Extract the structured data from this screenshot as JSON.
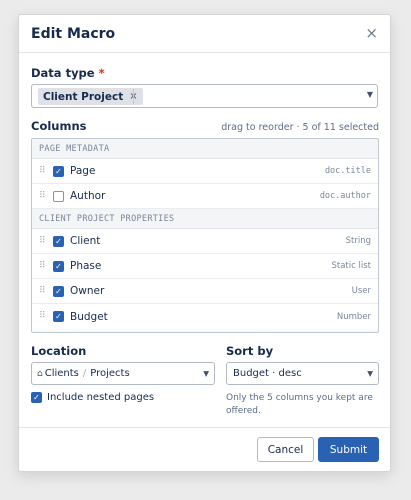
{
  "dialog": {
    "title": "Edit Macro",
    "close_glyph": "×"
  },
  "data_type": {
    "label": "Data type",
    "required_mark": "*",
    "selected_chip": "Client Project",
    "chip_remove_glyph": "×"
  },
  "columns": {
    "label": "Columns",
    "hint": "drag to reorder · 5 of 11 selected",
    "groups": [
      {
        "heading": "PAGE METADATA",
        "rows": [
          {
            "label": "Page",
            "meta": "doc.title",
            "checked": true
          },
          {
            "label": "Author",
            "meta": "doc.author",
            "checked": false
          }
        ]
      },
      {
        "heading": "CLIENT PROJECT PROPERTIES",
        "rows": [
          {
            "label": "Client",
            "meta": "String",
            "checked": true
          },
          {
            "label": "Phase",
            "meta": "Static list",
            "checked": true
          },
          {
            "label": "Owner",
            "meta": "User",
            "checked": true
          },
          {
            "label": "Budget",
            "meta": "Number",
            "checked": true
          }
        ]
      }
    ]
  },
  "location": {
    "label": "Location",
    "path": [
      "Clients",
      "Projects"
    ],
    "path_separator": "/",
    "include_nested_label": "Include nested pages",
    "include_nested_checked": true
  },
  "sort": {
    "label": "Sort by",
    "value": "Budget · desc",
    "note": "Only the 5 columns you kept are offered."
  },
  "footer": {
    "cancel_label": "Cancel",
    "submit_label": "Submit"
  },
  "icons": {
    "drag_handle": "⠿",
    "check": "✓",
    "home": "⌂",
    "caret": "▼"
  },
  "colors": {
    "accent": "#2a62b3",
    "required": "#de350b"
  }
}
